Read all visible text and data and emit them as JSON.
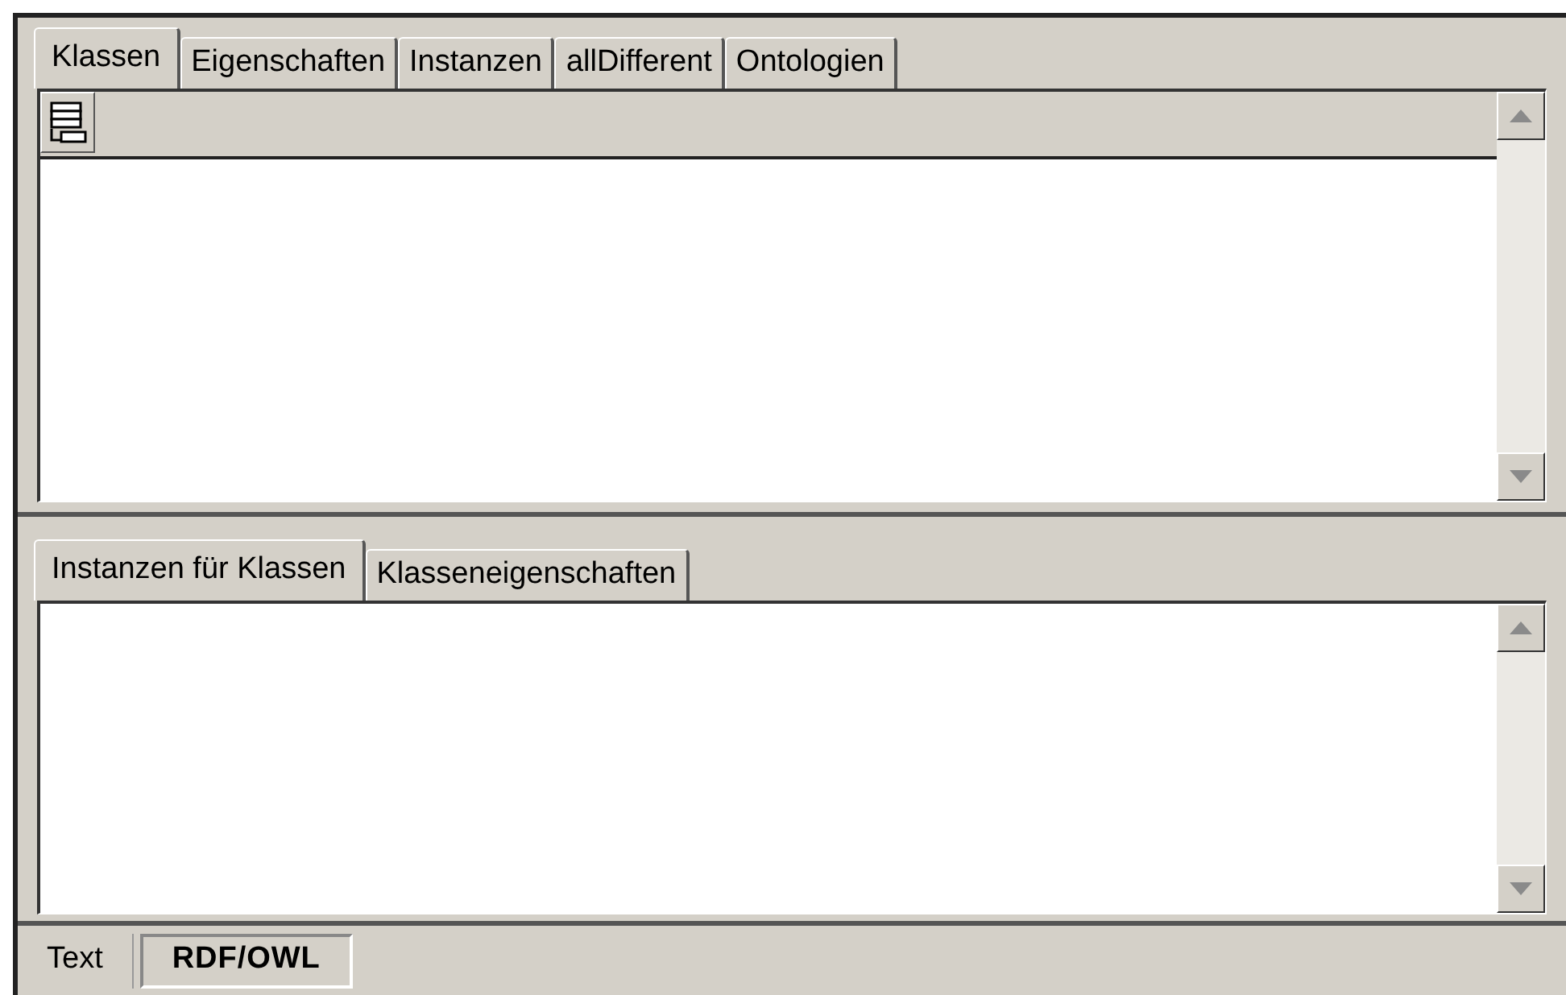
{
  "top_panel": {
    "tabs": [
      {
        "label": "Klassen",
        "selected": true
      },
      {
        "label": "Eigenschaften",
        "selected": false
      },
      {
        "label": "Instanzen",
        "selected": false
      },
      {
        "label": "allDifferent",
        "selected": false
      },
      {
        "label": "Ontologien",
        "selected": false
      }
    ]
  },
  "bottom_panel": {
    "tabs": [
      {
        "label": "Instanzen für Klassen",
        "selected": true
      },
      {
        "label": "Klasseneigenschaften",
        "selected": false
      }
    ]
  },
  "view_tabs": [
    {
      "label": "Text",
      "selected": false
    },
    {
      "label": "RDF/OWL",
      "selected": true
    }
  ]
}
